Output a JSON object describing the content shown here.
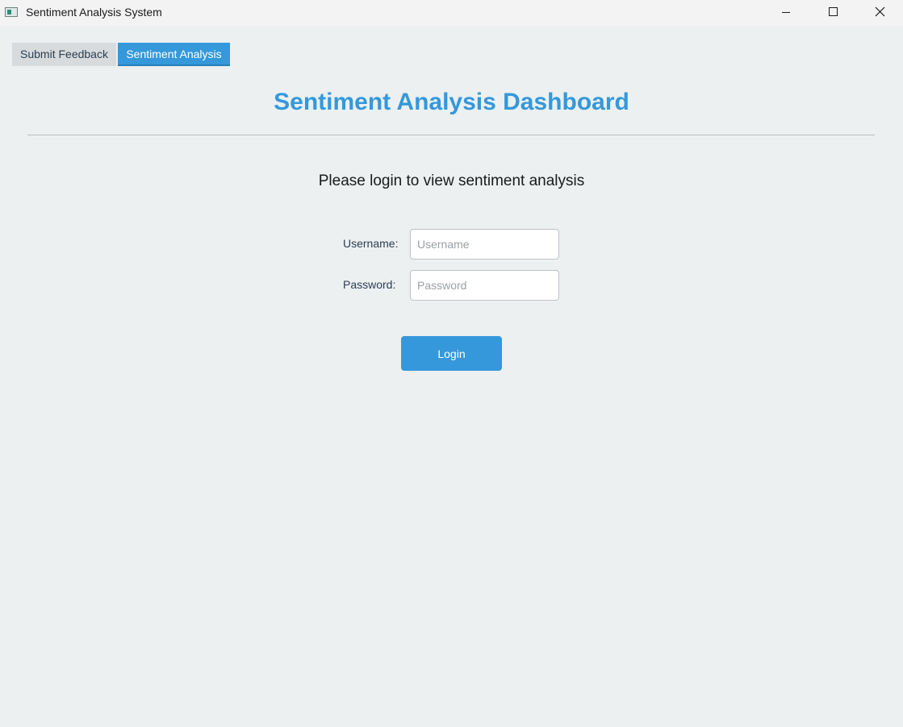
{
  "window": {
    "title": "Sentiment Analysis System"
  },
  "titlebar_controls": {
    "minimize_icon": "minimize-icon",
    "maximize_icon": "maximize-icon",
    "close_icon": "close-icon"
  },
  "tabs": [
    {
      "label": "Submit Feedback",
      "active": false
    },
    {
      "label": "Sentiment Analysis",
      "active": true
    }
  ],
  "main": {
    "heading": "Sentiment Analysis Dashboard",
    "prompt": "Please login to view sentiment analysis"
  },
  "login_form": {
    "username_label": "Username:",
    "username_placeholder": "Username",
    "username_value": "",
    "password_label": "Password:",
    "password_placeholder": "Password",
    "password_value": "",
    "login_button_label": "Login"
  },
  "colors": {
    "accent": "#3498db",
    "background": "#ecf0f1",
    "inactive_tab": "#d7dbdd",
    "text_dark": "#2c3e50"
  }
}
